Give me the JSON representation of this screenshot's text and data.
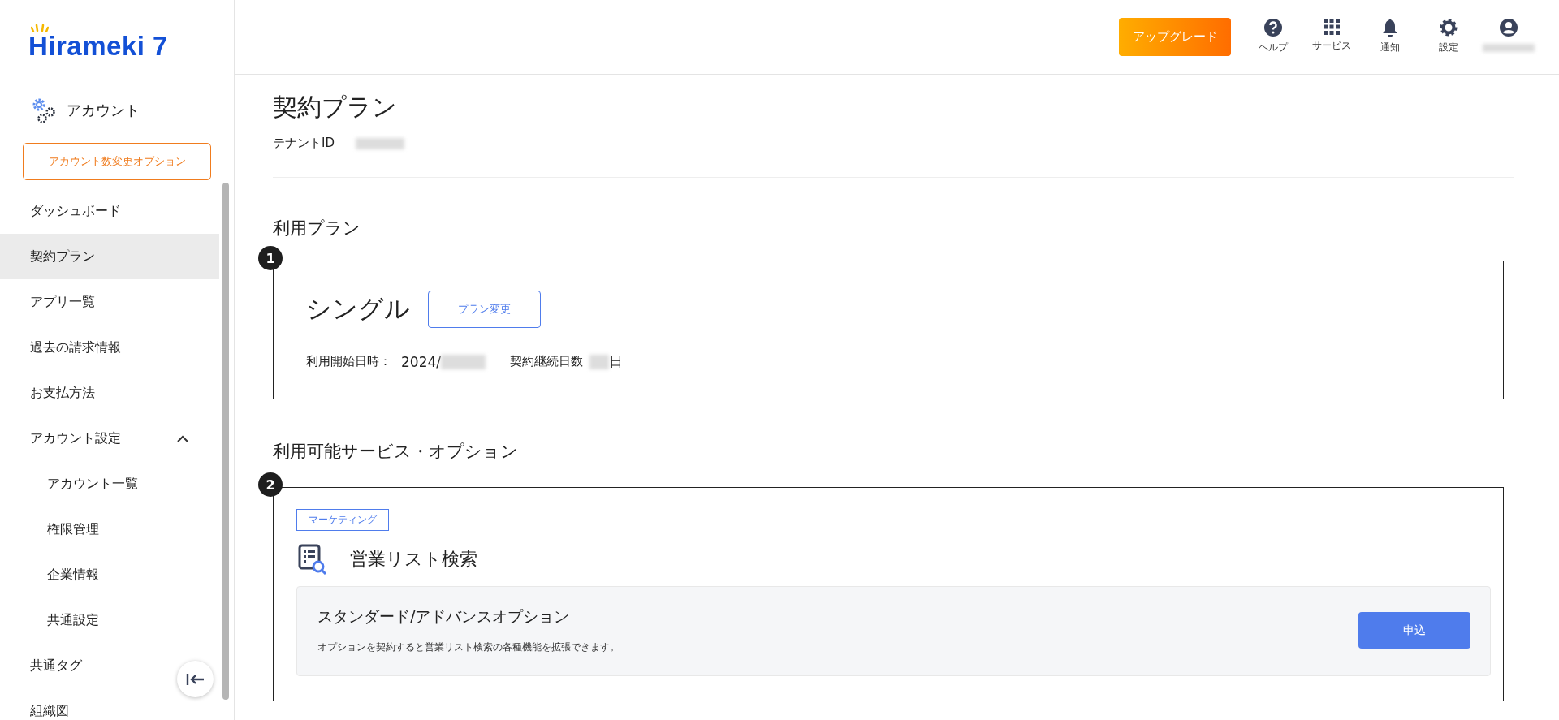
{
  "header": {
    "upgrade_button": "アップグレード",
    "tools": [
      {
        "kind": "help",
        "label": "ヘルプ"
      },
      {
        "kind": "grid",
        "label": "サービス"
      },
      {
        "kind": "bell",
        "label": "通知"
      },
      {
        "kind": "gear",
        "label": "設定"
      },
      {
        "kind": "user"
      }
    ]
  },
  "sidebar": {
    "logo": "Hirameki 7",
    "section_title": "アカウント",
    "option_button": "アカウント数変更オプション",
    "items": [
      {
        "label": "ダッシュボード",
        "selected": false
      },
      {
        "label": "契約プラン",
        "selected": true
      },
      {
        "label": "アプリ一覧",
        "selected": false
      },
      {
        "label": "過去の請求情報",
        "selected": false
      },
      {
        "label": "お支払方法",
        "selected": false
      },
      {
        "label": "アカウント設定",
        "selected": false,
        "expanded": true,
        "children": [
          {
            "label": "アカウント一覧",
            "selected": false
          },
          {
            "label": "権限管理",
            "selected": false
          },
          {
            "label": "企業情報",
            "selected": false
          },
          {
            "label": "共通設定",
            "selected": false
          }
        ]
      },
      {
        "label": "共通タグ",
        "selected": false
      },
      {
        "label": "組織図",
        "selected": false
      }
    ]
  },
  "page": {
    "title": "契約プラン",
    "tenant_label": "テナントID"
  },
  "plan_section": {
    "heading": "利用プラン",
    "badge": "1",
    "plan_name": "シングル",
    "change_button": "プラン変更",
    "start_label": "利用開始日時：",
    "start_value": "2024/",
    "days_label": "契約継続日数",
    "days_unit": "日"
  },
  "services_section": {
    "heading": "利用可能サービス・オプション",
    "badge": "2",
    "services": [
      {
        "tag": "マーケティング",
        "name": "営業リスト検索",
        "options": [
          {
            "title": "スタンダード/アドバンスオプション",
            "description": "オプションを契約すると営業リスト検索の各種機能を拡張できます。",
            "button": "申込"
          }
        ]
      }
    ]
  }
}
